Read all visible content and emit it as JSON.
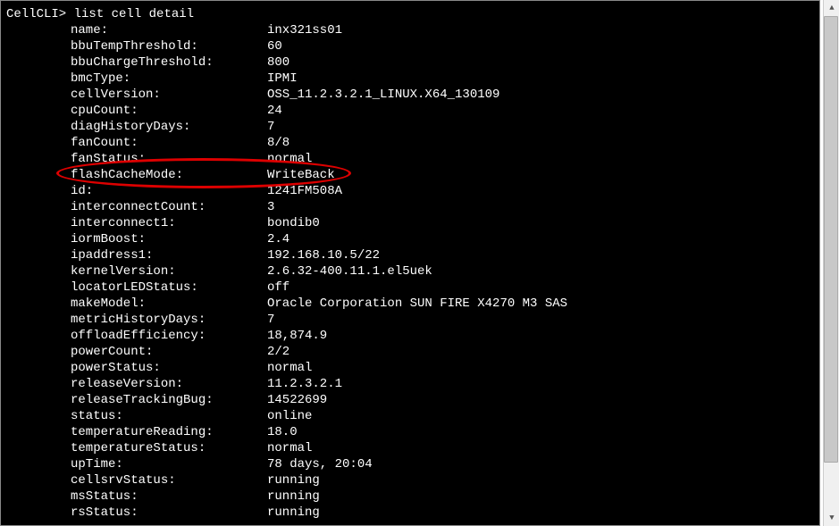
{
  "prompt": "CellCLI> ",
  "command": "list cell detail",
  "rows": [
    {
      "key": "name:",
      "val": "inx321ss01"
    },
    {
      "key": "bbuTempThreshold:",
      "val": "60"
    },
    {
      "key": "bbuChargeThreshold:",
      "val": "800"
    },
    {
      "key": "bmcType:",
      "val": "IPMI"
    },
    {
      "key": "cellVersion:",
      "val": "OSS_11.2.3.2.1_LINUX.X64_130109"
    },
    {
      "key": "cpuCount:",
      "val": "24"
    },
    {
      "key": "diagHistoryDays:",
      "val": "7"
    },
    {
      "key": "fanCount:",
      "val": "8/8"
    },
    {
      "key": "fanStatus:",
      "val": "normal"
    },
    {
      "key": "flashCacheMode:",
      "val": "WriteBack"
    },
    {
      "key": "id:",
      "val": "1241FM508A"
    },
    {
      "key": "interconnectCount:",
      "val": "3"
    },
    {
      "key": "interconnect1:",
      "val": "bondib0"
    },
    {
      "key": "iormBoost:",
      "val": "2.4"
    },
    {
      "key": "ipaddress1:",
      "val": "192.168.10.5/22"
    },
    {
      "key": "kernelVersion:",
      "val": "2.6.32-400.11.1.el5uek"
    },
    {
      "key": "locatorLEDStatus:",
      "val": "off"
    },
    {
      "key": "makeModel:",
      "val": "Oracle Corporation SUN FIRE X4270 M3 SAS"
    },
    {
      "key": "metricHistoryDays:",
      "val": "7"
    },
    {
      "key": "offloadEfficiency:",
      "val": "18,874.9"
    },
    {
      "key": "powerCount:",
      "val": "2/2"
    },
    {
      "key": "powerStatus:",
      "val": "normal"
    },
    {
      "key": "releaseVersion:",
      "val": "11.2.3.2.1"
    },
    {
      "key": "releaseTrackingBug:",
      "val": "14522699"
    },
    {
      "key": "status:",
      "val": "online"
    },
    {
      "key": "temperatureReading:",
      "val": "18.0"
    },
    {
      "key": "temperatureStatus:",
      "val": "normal"
    },
    {
      "key": "upTime:",
      "val": "78 days, 20:04"
    },
    {
      "key": "cellsrvStatus:",
      "val": "running"
    },
    {
      "key": "msStatus:",
      "val": "running"
    },
    {
      "key": "rsStatus:",
      "val": "running"
    }
  ],
  "highlight": {
    "rowIndex": 9
  },
  "scrollbar": {
    "thumbTop": 18,
    "thumbHeight": 500
  }
}
